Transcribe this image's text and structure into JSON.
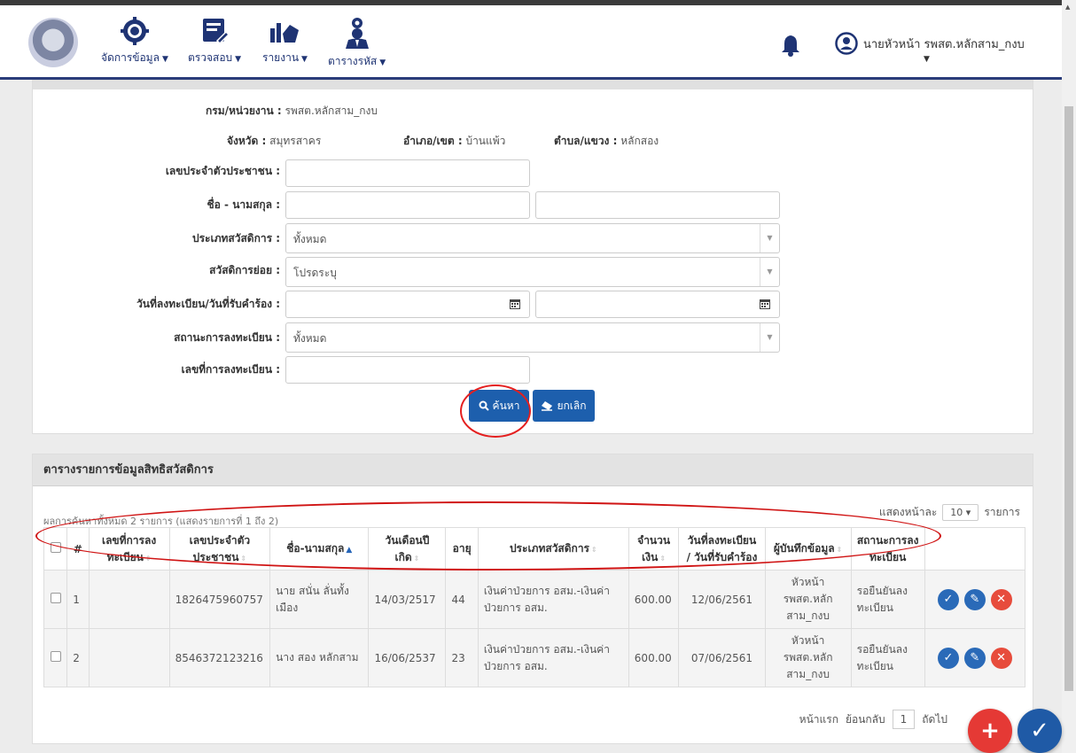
{
  "nav": {
    "menu": [
      {
        "label": "จัดการข้อมูล",
        "icon": "gear-icon"
      },
      {
        "label": "ตรวจสอบ",
        "icon": "edit-document-icon"
      },
      {
        "label": "รายงาน",
        "icon": "chart-icon"
      },
      {
        "label": "ตารางรหัส",
        "icon": "user-settings-icon"
      }
    ],
    "user_name": "นายหัวหน้า รพสต.หลักสาม_กงบ",
    "accent": "#1f3474"
  },
  "search": {
    "dept_label": "กรม/หน่วยงาน :",
    "dept_value": "รพสต.หลักสาม_กงบ",
    "province_label": "จังหวัด :",
    "province_value": "สมุทรสาคร",
    "district_label": "อำเภอ/เขต :",
    "district_value": "บ้านแพ้ว",
    "subdistrict_label": "ตำบล/แขวง :",
    "subdistrict_value": "หลักสอง",
    "id_label": "เลขประจำตัวประชาชน :",
    "name_label": "ชื่อ - นามสกุล :",
    "welfare_type_label": "ประเภทสวัสดิการ :",
    "welfare_type_value": "ทั้งหมด",
    "sub_welfare_label": "สวัสดิการย่อย :",
    "sub_welfare_value": "โปรดระบุ",
    "date_label": "วันที่ลงทะเบียน/วันที่รับคำร้อง :",
    "status_label": "สถานะการลงทะเบียน :",
    "status_value": "ทั้งหมด",
    "regno_label": "เลขที่การลงทะเบียน :",
    "search_button": "ค้นหา",
    "cancel_button": "ยกเลิก"
  },
  "table": {
    "title": "ตารางรายการข้อมูลสิทธิสวัสดิการ",
    "page_size_label": "แสดงหน้าละ",
    "page_size_value": "10",
    "page_size_suffix": "รายการ",
    "summary": "ผลการค้นหาทั้งหมด 2 รายการ (แสดงรายการที่ 1 ถึง 2)",
    "columns": [
      "#",
      "เลขที่การลงทะเบียน",
      "เลขประจำตัวประชาชน",
      "ชื่อ-นามสกุล",
      "วันเดือนปีเกิด",
      "อายุ",
      "ประเภทสวัสดิการ",
      "จำนวนเงิน",
      "วันที่ลงทะเบียน / วันที่รับคำร้อง",
      "ผู้บันทึกข้อมูล",
      "สถานะการลงทะเบียน"
    ],
    "rows": [
      {
        "no": "1",
        "regno": "",
        "id": "1826475960757",
        "name": "นาย สนั่น ลั่นทั้งเมือง",
        "dob": "14/03/2517",
        "age": "44",
        "welfare": "เงินค่าป่วยการ อสม.-เงินค่าป่วยการ อสม.",
        "amount": "600.00",
        "regdate": "12/06/2561",
        "recorder": "หัวหน้า รพสต.หลักสาม_กงบ",
        "status": "รอยืนยันลงทะเบียน"
      },
      {
        "no": "2",
        "regno": "",
        "id": "8546372123216",
        "name": "นาง สอง หลักสาม",
        "dob": "16/06/2537",
        "age": "23",
        "welfare": "เงินค่าป่วยการ อสม.-เงินค่าป่วยการ อสม.",
        "amount": "600.00",
        "regdate": "07/06/2561",
        "recorder": "หัวหน้า รพสต.หลักสาม_กงบ",
        "status": "รอยืนยันลงทะเบียน"
      }
    ],
    "pager": {
      "first": "หน้าแรก",
      "prev": "ย้อนกลับ",
      "current": "1",
      "next": "ถัดไป"
    }
  }
}
